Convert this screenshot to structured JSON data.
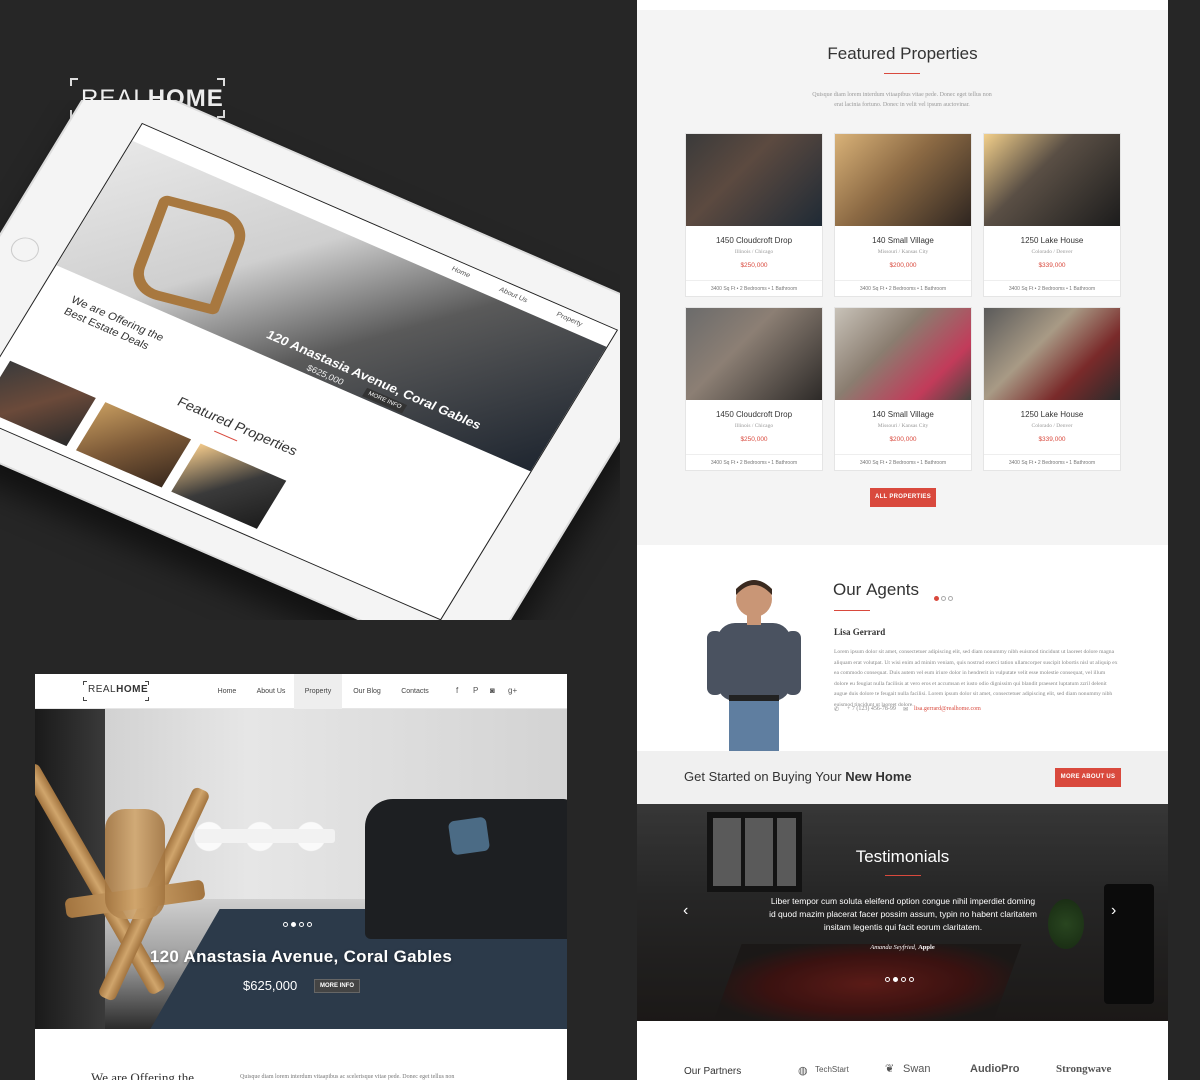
{
  "brand": {
    "left": "REAL",
    "right": "HOME"
  },
  "tablet": {
    "nav": [
      "Home",
      "About Us",
      "Property"
    ],
    "hero_title": "120 Anastasia Avenue, Coral Gables",
    "hero_price": "$625,000",
    "more_label": "MORE INFO",
    "tagline_line1": "We are Offering the",
    "tagline_line2": "Best Estate Deals",
    "featured_left": "Featured",
    "featured_right": "Properties"
  },
  "browser": {
    "logo_left": "REAL",
    "logo_right": "HOME",
    "menu": [
      "Home",
      "About Us",
      "Property",
      "Our Blog",
      "Contacts"
    ],
    "social": [
      {
        "icon": "facebook-icon",
        "glyph": "f"
      },
      {
        "icon": "pinterest-icon",
        "glyph": "P"
      },
      {
        "icon": "instagram-icon",
        "glyph": "◙"
      },
      {
        "icon": "google-plus-icon",
        "glyph": "g+"
      }
    ],
    "hero_title": "120 Anastasia Avenue, Coral Gables",
    "hero_price": "$625,000",
    "more_label": "MORE INFO",
    "intro_title": "We are Offering the",
    "intro_text": "Quisque diam lorem interdum vitaapibus ac scelerisque vitae pede. Donec eget tellus non"
  },
  "featured": {
    "title_light": "Featured",
    "title_bold": "Properties",
    "description_line1": "Quisque diam lorem interdum vitaapibus vitae pede. Donec eget tellus non",
    "description_line2": "erat lacinia fortuno. Donec in velit vel ipsum auctovinar.",
    "button": "ALL PROPERTIES",
    "properties": [
      {
        "name": "1450 Cloudcroft Drop",
        "location": "Illinois / Chicago",
        "price": "$250,000",
        "meta": "3400 Sq Ft   •   2 Bedrooms   •   1 Bathroom"
      },
      {
        "name": "140 Small Village",
        "location": "Missouri / Kansas City",
        "price": "$200,000",
        "meta": "3400 Sq Ft   •   2 Bedrooms   •   1 Bathroom"
      },
      {
        "name": "1250 Lake House",
        "location": "Colorado / Denver",
        "price": "$339,000",
        "meta": "3400 Sq Ft   •   2 Bedrooms   •   1 Bathroom"
      },
      {
        "name": "1450 Cloudcroft Drop",
        "location": "Illinois / Chicago",
        "price": "$250,000",
        "meta": "3400 Sq Ft   •   2 Bedrooms   •   1 Bathroom"
      },
      {
        "name": "140 Small Village",
        "location": "Missouri / Kansas City",
        "price": "$200,000",
        "meta": "3400 Sq Ft   •   2 Bedrooms   •   1 Bathroom"
      },
      {
        "name": "1250 Lake House",
        "location": "Colorado / Denver",
        "price": "$339,000",
        "meta": "3400 Sq Ft   •   2 Bedrooms   •   1 Bathroom"
      }
    ]
  },
  "agents": {
    "title_light": "Our",
    "title_bold": "Agents",
    "name": "Lisa Gerrard",
    "bio": "Lorem ipsum dolor sit amet, consectetuer adipiscing elit, sed diam nonummy nibh euismod tincidunt ut laoreet dolore magna aliquam erat volutpat. Ut wisi enim ad minim veniam, quis nostrud exerci tation ullamcorper suscipit lobortis nisl ut aliquip ex ea commodo consequat. Duis autem vel eum iriure dolor in hendrerit in vulputate velit esse molestie consequat, vel illum dolore eu feugiat nulla facilisis at vero eros et accumsan et iusto odio dignissim qui blandit praesent luptatum zzril delenit augue duis dolore te feugait nulla facilisi. Lorem ipsum dolor sit amet, consectetuer adipiscing elit, sed diam nonummy nibh euismod tincidunt ut laoreet dolore.",
    "phone": "+ 7 (123) 456-78-99",
    "email": "lisa.gerrard@realhome.com"
  },
  "cta": {
    "text_light": "Get Started on Buying Your",
    "text_bold": "New Home",
    "button": "MORE ABOUT US"
  },
  "testimonials": {
    "title": "Testimonials",
    "quote": "Liber tempor cum soluta eleifend option congue nihil imperdiet doming id quod mazim placerat facer possim assum, typin no habent claritatem insitam legentis qui facit eorum claritatem.",
    "author": "Amanda Seyfried,",
    "company": "Apple"
  },
  "partners": {
    "label": "Our Partners",
    "logos": [
      "TechStart",
      "Swan",
      "AudioPro",
      "Strongwave"
    ]
  },
  "colors": {
    "accent": "#d9493d",
    "background": "#262626"
  }
}
